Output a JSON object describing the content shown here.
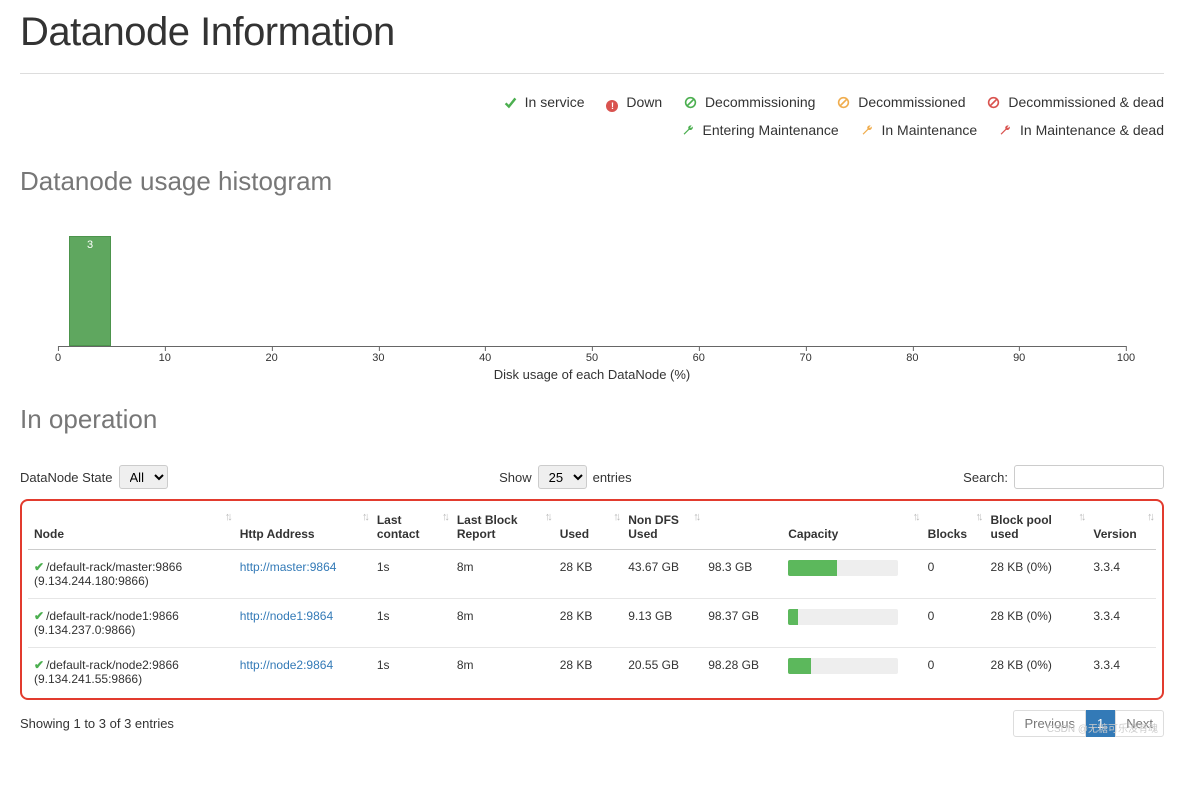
{
  "page_title": "Datanode Information",
  "legend": {
    "in_service": "In service",
    "down": "Down",
    "decommissioning": "Decommissioning",
    "decommissioned": "Decommissioned",
    "decommissioned_dead": "Decommissioned & dead",
    "entering_maintenance": "Entering Maintenance",
    "in_maintenance": "In Maintenance",
    "in_maintenance_dead": "In Maintenance & dead"
  },
  "histogram": {
    "heading": "Datanode usage histogram",
    "xlabel": "Disk usage of each DataNode (%)",
    "bar_value": "3"
  },
  "chart_data": {
    "type": "bar",
    "title": "Datanode usage histogram",
    "xlabel": "Disk usage of each DataNode (%)",
    "ylabel": "",
    "categories": [
      0,
      10,
      20,
      30,
      40,
      50,
      60,
      70,
      80,
      90,
      100
    ],
    "values": [
      3,
      0,
      0,
      0,
      0,
      0,
      0,
      0,
      0,
      0,
      0
    ],
    "ylim": [
      0,
      3
    ]
  },
  "section_in_operation": "In operation",
  "controls": {
    "state_label": "DataNode State",
    "state_value": "All",
    "show_label": "Show",
    "show_value": "25",
    "entries_label": "entries",
    "search_label": "Search:",
    "search_value": ""
  },
  "table": {
    "headers": {
      "node": "Node",
      "http": "Http Address",
      "last_contact": "Last contact",
      "last_block_report": "Last Block Report",
      "used": "Used",
      "non_dfs_used": "Non DFS Used",
      "capacity": "Capacity",
      "blocks": "Blocks",
      "block_pool_used": "Block pool used",
      "version": "Version"
    },
    "rows": [
      {
        "node_line1": "/default-rack/master:9866",
        "node_line2": "(9.134.244.180:9866)",
        "http_text": "http://master:9864",
        "last_contact": "1s",
        "last_block_report": "8m",
        "used": "28 KB",
        "non_dfs_used": "43.67 GB",
        "capacity_text": "98.3 GB",
        "capacity_pct": 44,
        "blocks": "0",
        "block_pool_used": "28 KB (0%)",
        "version": "3.3.4"
      },
      {
        "node_line1": "/default-rack/node1:9866",
        "node_line2": "(9.134.237.0:9866)",
        "http_text": "http://node1:9864",
        "last_contact": "1s",
        "last_block_report": "8m",
        "used": "28 KB",
        "non_dfs_used": "9.13 GB",
        "capacity_text": "98.37 GB",
        "capacity_pct": 9,
        "blocks": "0",
        "block_pool_used": "28 KB (0%)",
        "version": "3.3.4"
      },
      {
        "node_line1": "/default-rack/node2:9866",
        "node_line2": "(9.134.241.55:9866)",
        "http_text": "http://node2:9864",
        "last_contact": "1s",
        "last_block_report": "8m",
        "used": "28 KB",
        "non_dfs_used": "20.55 GB",
        "capacity_text": "98.28 GB",
        "capacity_pct": 21,
        "blocks": "0",
        "block_pool_used": "28 KB (0%)",
        "version": "3.3.4"
      }
    ]
  },
  "footer": {
    "showing": "Showing 1 to 3 of 3 entries",
    "previous": "Previous",
    "current_page": "1",
    "next": "Next"
  },
  "watermark": "CSDN @无糖可乐没有魂"
}
